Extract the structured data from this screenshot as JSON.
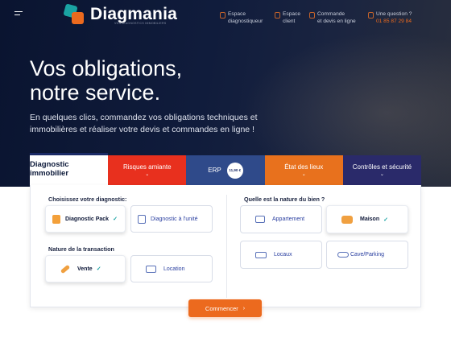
{
  "header": {
    "logo_name": "Diagmania",
    "logo_tagline": "VOS DIAGNOSTICS IMMOBILIERS",
    "nav": [
      {
        "label_line1": "Espace",
        "label_line2": "diagnostiqueur",
        "icon": "user-icon"
      },
      {
        "label_line1": "Espace",
        "label_line2": "client",
        "icon": "user-icon"
      },
      {
        "label_line1": "Commande",
        "label_line2": "et devis en ligne",
        "icon": "cart-icon"
      }
    ],
    "question_label": "Une question ?",
    "phone": "01 85 87 29 84"
  },
  "hero": {
    "title_line1": "Vos obligations,",
    "title_line2": "notre service.",
    "subtitle": "En quelques clics, commandez vos obligations techniques et immobilières et réaliser votre devis et commandes en ligne !"
  },
  "tabs": [
    {
      "label": "Diagnostic immobilier",
      "active": true
    },
    {
      "label": "Risques amiante",
      "color": "#e8301e"
    },
    {
      "label": "ERP",
      "price": "11,90 €",
      "color": "#2f4a8a"
    },
    {
      "label": "État des lieux",
      "color": "#e8711d"
    },
    {
      "label": "Contrôles et sécurité",
      "color": "#2a2a6a"
    }
  ],
  "form": {
    "diag_label": "Choisissez votre diagnostic:",
    "diag_options": [
      {
        "label": "Diagnostic Pack",
        "selected": true,
        "icon": "pack-icon"
      },
      {
        "label": "Diagnostic à l'unité",
        "selected": false,
        "icon": "document-icon"
      }
    ],
    "transaction_label": "Nature de la transaction",
    "transaction_options": [
      {
        "label": "Vente",
        "selected": true,
        "icon": "key-icon"
      },
      {
        "label": "Location",
        "selected": false,
        "icon": "location-icon"
      }
    ],
    "property_label": "Quelle est la nature du bien ?",
    "property_options": [
      {
        "label": "Appartement",
        "selected": false,
        "icon": "apartment-icon"
      },
      {
        "label": "Maison",
        "selected": true,
        "icon": "house-icon"
      },
      {
        "label": "Locaux",
        "selected": false,
        "icon": "premises-icon"
      },
      {
        "label": "Cave/Parking",
        "selected": false,
        "icon": "car-icon"
      }
    ],
    "check_glyph": "✓",
    "start_label": "Commencer",
    "start_arrow": "›"
  },
  "colors": {
    "accent": "#ec6a1e",
    "teal": "#1aa3a3",
    "navy": "#0a1430"
  }
}
